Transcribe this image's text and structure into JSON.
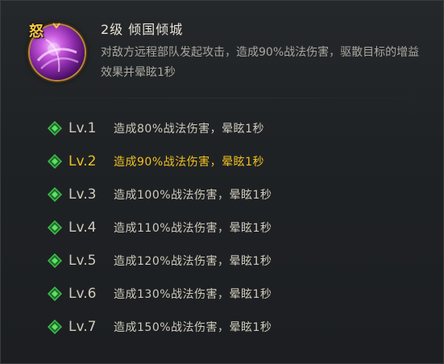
{
  "skill": {
    "icon": "purple-swirl-skill-icon",
    "rage_badge": "怒",
    "title": "2级  倾国倾城",
    "description": "对敌方远程部队发起攻击，造成90%战法伤害，驱散目标的增益效果并晕眩1秒"
  },
  "levels": [
    {
      "label": "Lv.1",
      "effect": "造成80%战法伤害，晕眩1秒",
      "current": false
    },
    {
      "label": "Lv.2",
      "effect": "造成90%战法伤害，晕眩1秒",
      "current": true
    },
    {
      "label": "Lv.3",
      "effect": "造成100%战法伤害，晕眩1秒",
      "current": false
    },
    {
      "label": "Lv.4",
      "effect": "造成110%战法伤害，晕眩1秒",
      "current": false
    },
    {
      "label": "Lv.5",
      "effect": "造成120%战法伤害，晕眩1秒",
      "current": false
    },
    {
      "label": "Lv.6",
      "effect": "造成130%战法伤害，晕眩1秒",
      "current": false
    },
    {
      "label": "Lv.7",
      "effect": "造成150%战法伤害，晕眩1秒",
      "current": false
    }
  ],
  "colors": {
    "current_level": "#f0c020",
    "normal_level": "#cfcabb",
    "gem_green": "#3fbf4a",
    "rage_gold": "#f4c842"
  }
}
